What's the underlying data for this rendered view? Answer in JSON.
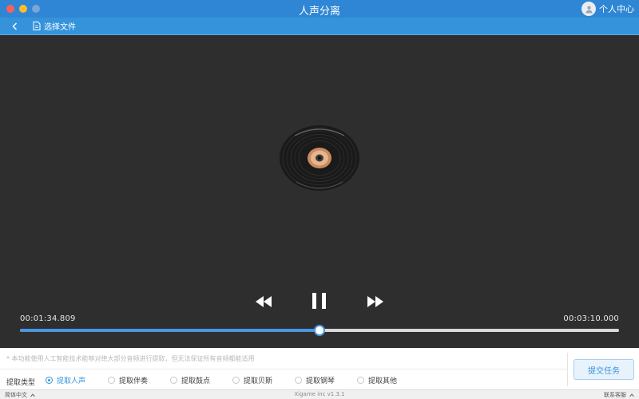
{
  "window": {
    "title": "人声分离",
    "user_label": "个人中心"
  },
  "toolbar": {
    "choose_file": "选择文件"
  },
  "player": {
    "current_time": "00:01:34.809",
    "total_time": "00:03:10.000",
    "progress": 0.5,
    "state": "playing"
  },
  "panel": {
    "notice": "* 本功能使用人工智能技术能够对绝大部分音频进行提取，但无法保证所有音频都能适用",
    "type_label": "提取类型",
    "options": [
      {
        "label": "提取人声",
        "selected": true
      },
      {
        "label": "提取伴奏",
        "selected": false
      },
      {
        "label": "提取鼓点",
        "selected": false
      },
      {
        "label": "提取贝斯",
        "selected": false
      },
      {
        "label": "提取钢琴",
        "selected": false
      },
      {
        "label": "提取其他",
        "selected": false
      }
    ],
    "submit": "提交任务"
  },
  "status": {
    "language": "简体中文",
    "version": "Xigame inc v1.3.1",
    "support": "联系客服"
  },
  "colors": {
    "accent": "#3593dc",
    "titlebar": "#2f86d4",
    "background": "#2e2e2e"
  }
}
